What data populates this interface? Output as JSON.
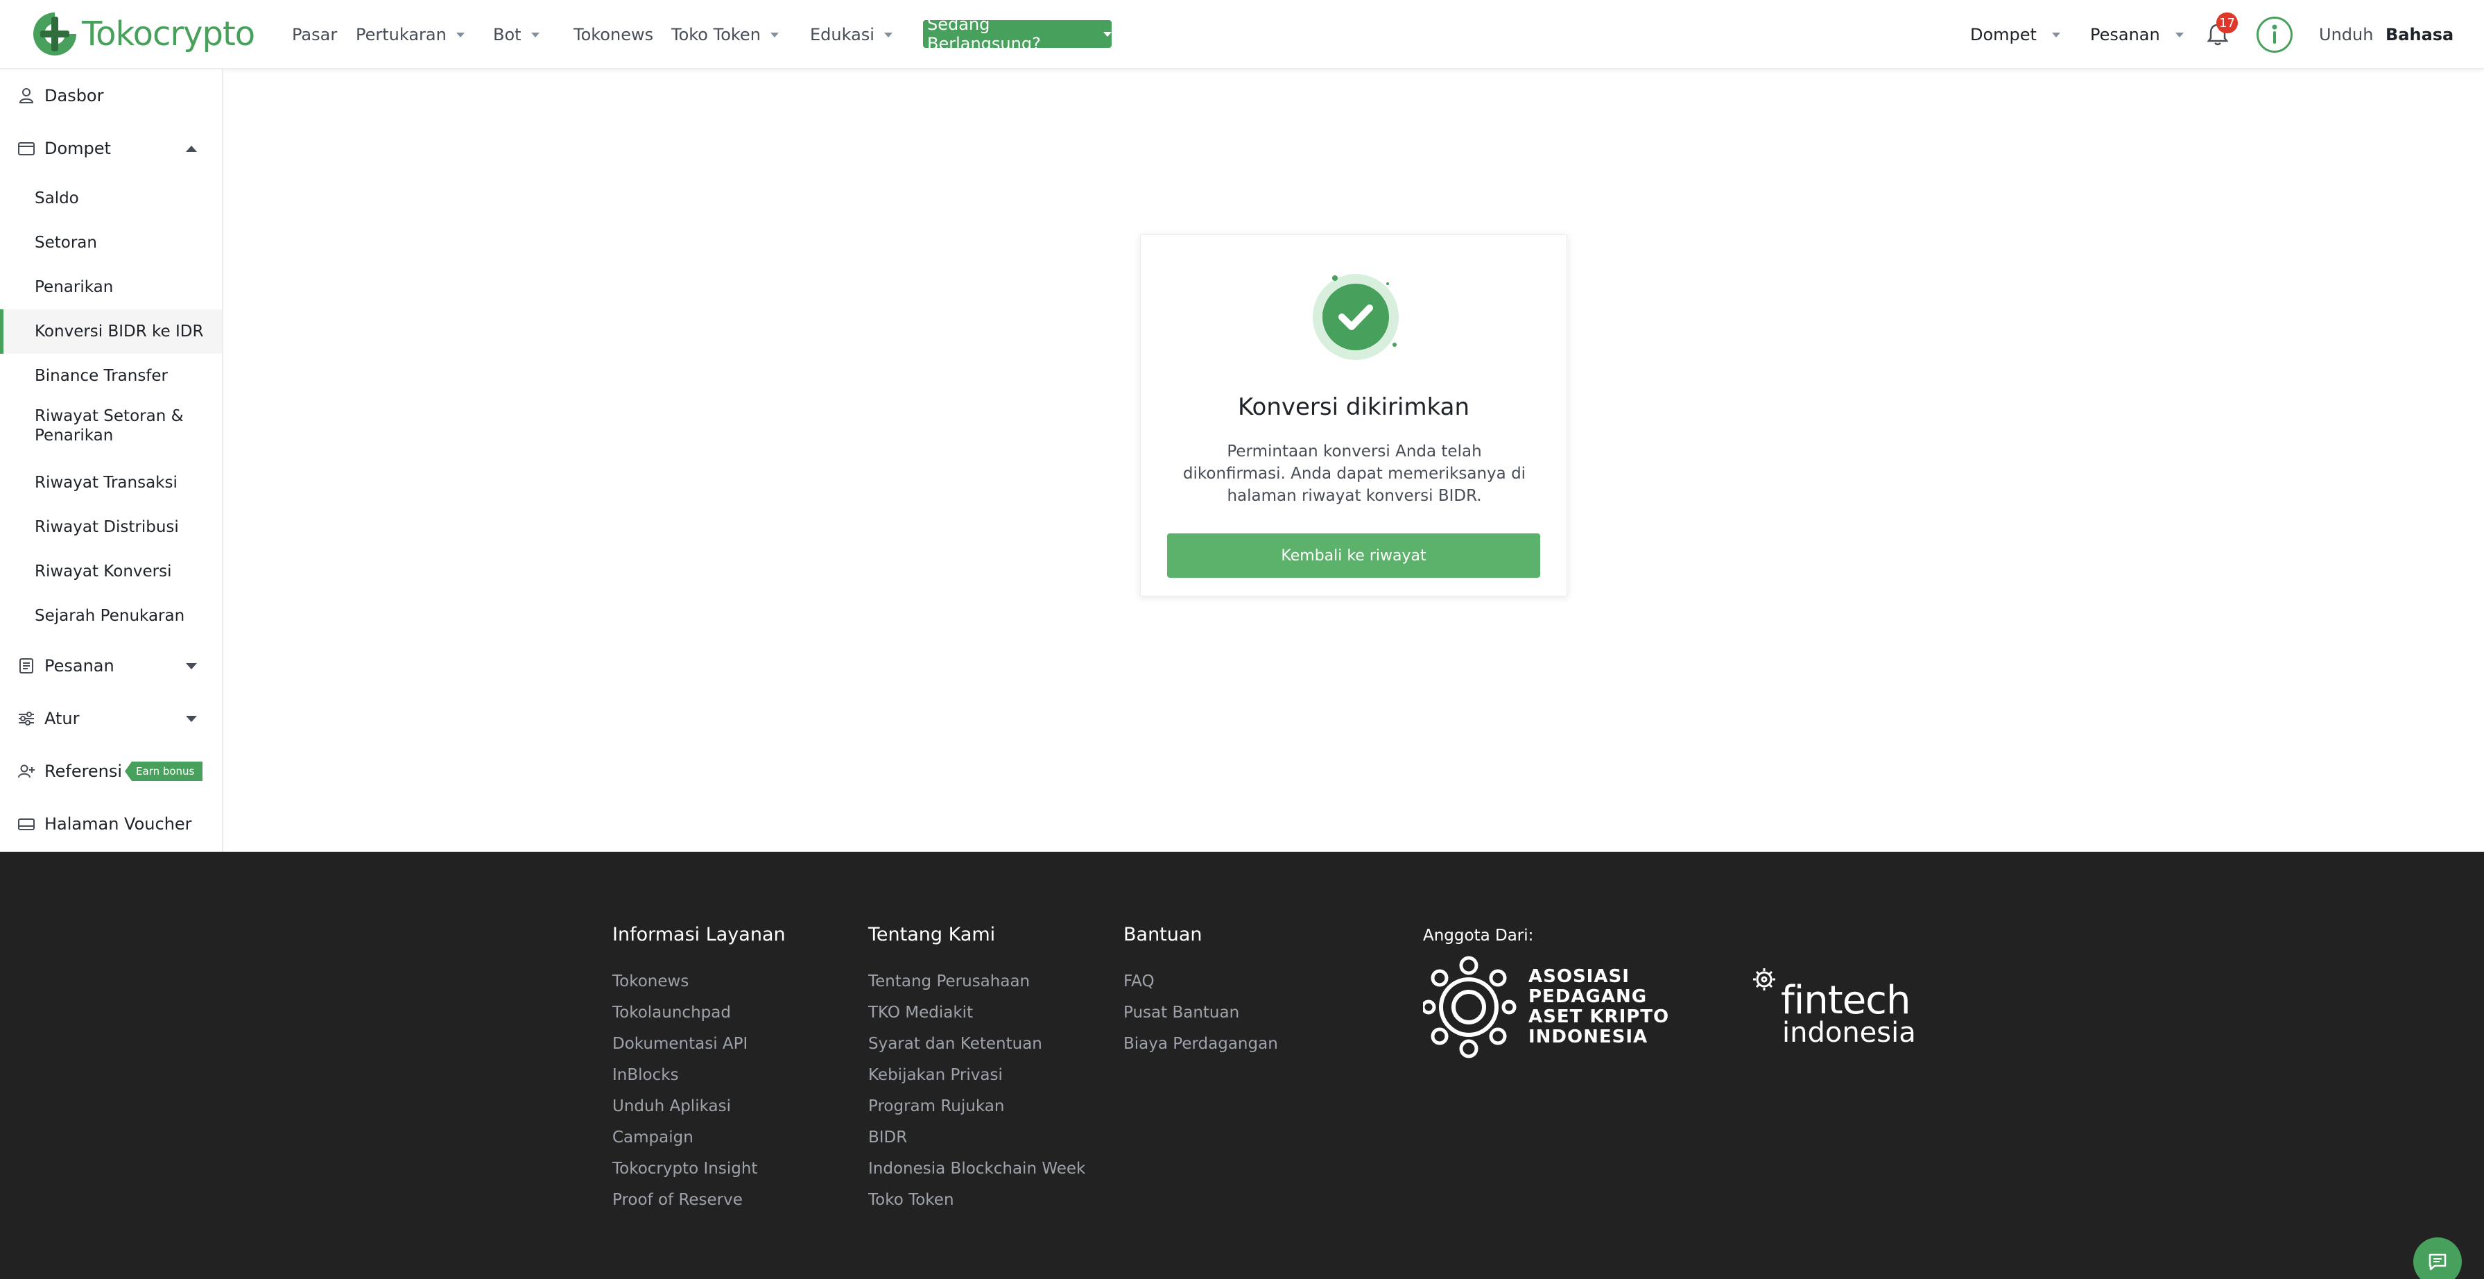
{
  "brand": {
    "name": "Tokocrypto",
    "accent": "#47a05b"
  },
  "nav": {
    "items": [
      "Pasar",
      "Pertukaran",
      "Bot",
      "Tokonews",
      "Toko Token",
      "Edukasi"
    ],
    "ongoing": "Sedang Berlangsung?",
    "wallet": "Dompet",
    "orders": "Pesanan",
    "notifications_count": "17",
    "download": "Unduh",
    "language": "Bahasa"
  },
  "sidebar": {
    "dashboard": "Dasbor",
    "wallet": "Dompet",
    "wallet_items": [
      "Saldo",
      "Setoran",
      "Penarikan",
      "Konversi BIDR ke IDR",
      "Binance Transfer",
      "Riwayat Setoran & Penarikan",
      "Riwayat Transaksi",
      "Riwayat Distribusi",
      "Riwayat Konversi",
      "Sejarah Penukaran"
    ],
    "orders": "Pesanan",
    "settings": "Atur",
    "referral": "Referensi",
    "earn_badge": "Earn bonus",
    "voucher": "Halaman Voucher"
  },
  "card": {
    "title": "Konversi dikirimkan",
    "message": "Permintaan konversi Anda telah dikonfirmasi. Anda dapat memeriksanya di halaman riwayat konversi BIDR.",
    "button": "Kembali ke riwayat"
  },
  "footer": {
    "columns": [
      {
        "heading": "Informasi Layanan",
        "links": [
          "Tokonews",
          "Tokolaunchpad",
          "Dokumentasi API",
          "InBlocks",
          "Unduh Aplikasi",
          "Campaign",
          "Tokocrypto Insight",
          "Proof of Reserve"
        ]
      },
      {
        "heading": "Tentang Kami",
        "links": [
          "Tentang Perusahaan",
          "TKO Mediakit",
          "Syarat dan Ketentuan",
          "Kebijakan Privasi",
          "Program Rujukan",
          "BIDR",
          "Indonesia Blockchain Week",
          "Toko Token"
        ]
      },
      {
        "heading": "Bantuan",
        "links": [
          "FAQ",
          "Pusat Bantuan",
          "Biaya Perdagangan"
        ]
      }
    ],
    "member_title": "Anggota Dari:",
    "aspakrindo_lines": [
      "ASOSIASI",
      "PEDAGANG",
      "ASET KRIPTO",
      "INDONESIA"
    ],
    "fintech_line1": "fintech",
    "fintech_line2": "indonesia"
  }
}
